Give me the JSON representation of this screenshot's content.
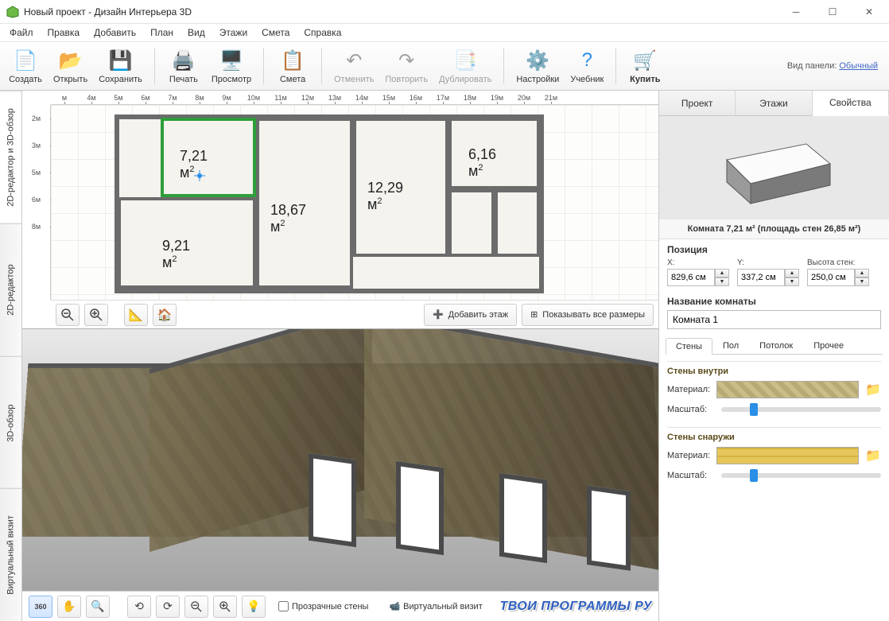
{
  "window": {
    "title": "Новый проект - Дизайн Интерьера 3D"
  },
  "menu": [
    "Файл",
    "Правка",
    "Добавить",
    "План",
    "Вид",
    "Этажи",
    "Смета",
    "Справка"
  ],
  "toolbar": {
    "create": "Создать",
    "open": "Открыть",
    "save": "Сохранить",
    "print": "Печать",
    "preview": "Просмотр",
    "estimate": "Смета",
    "undo": "Отменить",
    "redo": "Повторить",
    "duplicate": "Дублировать",
    "settings": "Настройки",
    "tutorial": "Учебник",
    "buy": "Купить"
  },
  "panel_mode": {
    "label": "Вид панели:",
    "value": "Обычный"
  },
  "left_tabs": [
    "2D-редактор и 3D-обзор",
    "2D-редактор",
    "3D-обзор",
    "Виртуальный визит"
  ],
  "ruler_h": [
    "м",
    "4м",
    "5м",
    "6м",
    "7м",
    "8м",
    "9м",
    "10м",
    "11м",
    "12м",
    "13м",
    "14м",
    "15м",
    "16м",
    "17м",
    "18м",
    "19м",
    "20м",
    "21м"
  ],
  "ruler_v": [
    "2м",
    "3м",
    "5м",
    "6м",
    "8м"
  ],
  "rooms": {
    "r1": "7,21 м",
    "r2": "6,16 м",
    "r3": "12,29 м",
    "r4": "18,67 м",
    "r5": "9,21 м"
  },
  "plan_buttons": {
    "add_floor": "Добавить этаж",
    "show_all_dims": "Показывать все размеры"
  },
  "footer": {
    "transparent_walls": "Прозрачные стены",
    "virtual_visit": "Виртуальный визит",
    "site": "ТВОИ ПРОГРАММЫ РУ"
  },
  "right_tabs": [
    "Проект",
    "Этажи",
    "Свойства"
  ],
  "room_summary": "Комната 7,21 м²  (площадь стен 26,85 м²)",
  "position": {
    "hdr": "Позиция",
    "x_label": "X:",
    "y_label": "Y:",
    "h_label": "Высота стен:",
    "x": "829,6 см",
    "y": "337,2 см",
    "h": "250,0 см"
  },
  "room_name": {
    "hdr": "Название комнаты",
    "value": "Комната 1"
  },
  "subtabs": [
    "Стены",
    "Пол",
    "Потолок",
    "Прочее"
  ],
  "walls": {
    "inside_hdr": "Стены внутри",
    "outside_hdr": "Стены снаружи",
    "material": "Материал:",
    "scale": "Масштаб:"
  }
}
